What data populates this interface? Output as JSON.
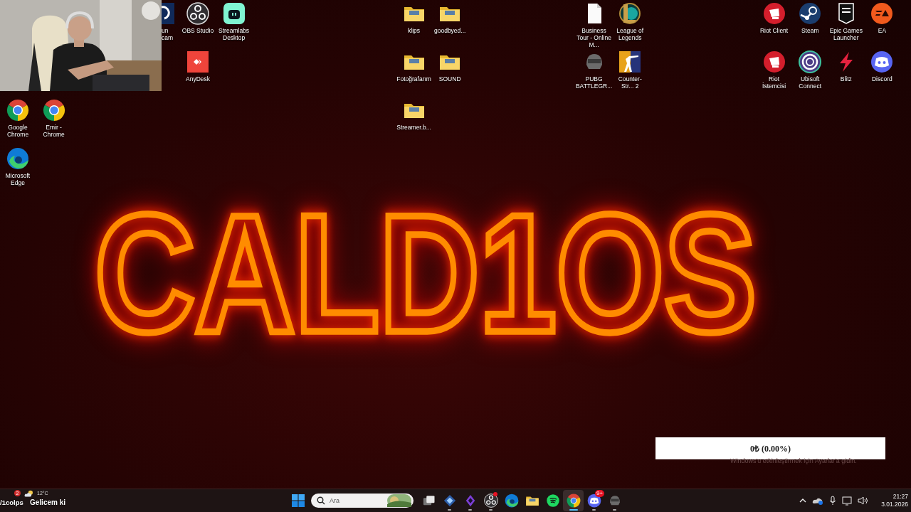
{
  "partial_icon": {
    "kind": "qcam",
    "label": "un\ncam"
  },
  "desktop_icons": [
    {
      "label": "OBS Studio",
      "kind": "obs"
    },
    {
      "label": "Streamlabs Desktop",
      "kind": "streamlabs"
    },
    {
      "label": "klips",
      "kind": "folder"
    },
    {
      "label": "goodbyed...",
      "kind": "folder"
    },
    {
      "label": "Business Tour - Online M...",
      "kind": "document"
    },
    {
      "label": "League of Legends",
      "kind": "lol"
    },
    {
      "label": "Riot Client",
      "kind": "riot"
    },
    {
      "label": "Steam",
      "kind": "steam"
    },
    {
      "label": "Epic Games Launcher",
      "kind": "epic"
    },
    {
      "label": "EA",
      "kind": "ea"
    },
    {
      "label": "AnyDesk",
      "kind": "anydesk"
    },
    {
      "label": "Fotoğrafarım",
      "kind": "folder"
    },
    {
      "label": "SOUND",
      "kind": "folder"
    },
    {
      "label": "PUBG BATTLEGR...",
      "kind": "pubg"
    },
    {
      "label": "Counter-Str... 2",
      "kind": "cs"
    },
    {
      "label": "Riot İstemcisi",
      "kind": "riot"
    },
    {
      "label": "Ubisoft Connect",
      "kind": "ubisoft"
    },
    {
      "label": "Blitz",
      "kind": "blitz"
    },
    {
      "label": "Discord",
      "kind": "discord"
    },
    {
      "label": "Google Chrome",
      "kind": "chrome"
    },
    {
      "label": "Emir - Chrome",
      "kind": "chrome"
    },
    {
      "label": "Streamer.b...",
      "kind": "folder"
    },
    {
      "label": "Microsoft Edge",
      "kind": "edge"
    }
  ],
  "wallpaper_text": "CALD1OS",
  "donation_widget": {
    "text": "0₺ (0.00%)"
  },
  "activation_notice": "Windows'u etkinleştirmek için Ayarlar'a gidin.",
  "chat_overlay": {
    "user": "/1colps",
    "message": "Gelicem ki"
  },
  "taskbar": {
    "weather": {
      "temperature": "12°C",
      "badge": "2"
    },
    "search": {
      "placeholder": "Ara"
    },
    "apps": [
      {
        "kind": "taskview",
        "running": false,
        "selected": false
      },
      {
        "kind": "diamond",
        "running": true,
        "selected": false
      },
      {
        "kind": "diamond2",
        "running": true,
        "selected": false
      },
      {
        "kind": "obs",
        "running": true,
        "selected": false,
        "alert": true
      },
      {
        "kind": "edge",
        "running": false,
        "selected": false
      },
      {
        "kind": "explorer",
        "running": false,
        "selected": false
      },
      {
        "kind": "spotify",
        "running": false,
        "selected": false
      },
      {
        "kind": "chrome",
        "running": true,
        "selected": true
      },
      {
        "kind": "discord",
        "running": true,
        "selected": false,
        "badge": "9+"
      },
      {
        "kind": "pubg",
        "running": true,
        "selected": false
      }
    ],
    "clock": {
      "time": "21:27",
      "date": "3.01.2026"
    }
  }
}
